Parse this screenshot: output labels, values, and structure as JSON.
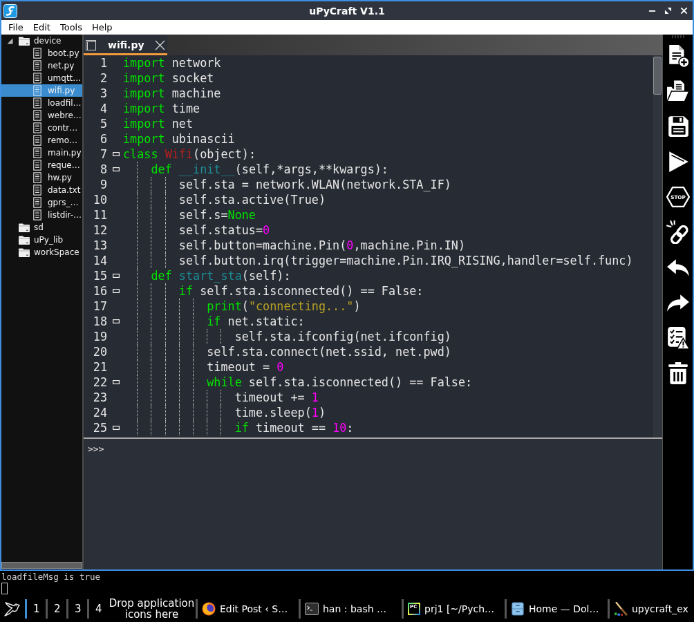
{
  "window": {
    "title": "uPyCraft V1.1"
  },
  "menu": [
    "File",
    "Edit",
    "Tools",
    "Help"
  ],
  "file_tree": [
    {
      "kind": "folder",
      "label": "device",
      "expanded": true,
      "selected": false,
      "children": [
        {
          "kind": "file",
          "label": "boot.py",
          "selected": false
        },
        {
          "kind": "file",
          "label": "net.py",
          "selected": false
        },
        {
          "kind": "file",
          "label": "umqtt…",
          "selected": false
        },
        {
          "kind": "file",
          "label": "wifi.py",
          "selected": true
        },
        {
          "kind": "file",
          "label": "loadfil…",
          "selected": false
        },
        {
          "kind": "file",
          "label": "webre…",
          "selected": false
        },
        {
          "kind": "file",
          "label": "contr…",
          "selected": false
        },
        {
          "kind": "file",
          "label": "remo…",
          "selected": false
        },
        {
          "kind": "file",
          "label": "main.py",
          "selected": false
        },
        {
          "kind": "file",
          "label": "reque…",
          "selected": false
        },
        {
          "kind": "file",
          "label": "hw.py",
          "selected": false
        },
        {
          "kind": "file",
          "label": "data.txt",
          "selected": false
        },
        {
          "kind": "file",
          "label": "gprs_…",
          "selected": false
        },
        {
          "kind": "file",
          "label": "listdir-…",
          "selected": false
        }
      ]
    },
    {
      "kind": "folder",
      "label": "sd",
      "selected": false
    },
    {
      "kind": "folder",
      "label": "uPy_lib",
      "selected": false
    },
    {
      "kind": "folder",
      "label": "workSpace",
      "selected": false
    }
  ],
  "editor": {
    "tabs": [
      {
        "label": "wifi.py",
        "selected": true
      }
    ],
    "lines": [
      {
        "number": "1",
        "collapsible": false,
        "tokens": [
          {
            "kind": "keyword",
            "text": "import"
          },
          {
            "kind": "plain",
            "text": " network"
          }
        ]
      },
      {
        "number": "2",
        "collapsible": false,
        "tokens": [
          {
            "kind": "keyword",
            "text": "import"
          },
          {
            "kind": "plain",
            "text": " socket"
          }
        ]
      },
      {
        "number": "3",
        "collapsible": false,
        "tokens": [
          {
            "kind": "keyword",
            "text": "import"
          },
          {
            "kind": "plain",
            "text": " machine"
          }
        ]
      },
      {
        "number": "4",
        "collapsible": false,
        "tokens": [
          {
            "kind": "keyword",
            "text": "import"
          },
          {
            "kind": "plain",
            "text": " time"
          }
        ]
      },
      {
        "number": "5",
        "collapsible": false,
        "tokens": [
          {
            "kind": "keyword",
            "text": "import"
          },
          {
            "kind": "plain",
            "text": " net"
          }
        ]
      },
      {
        "number": "6",
        "collapsible": false,
        "tokens": [
          {
            "kind": "keyword",
            "text": "import"
          },
          {
            "kind": "plain",
            "text": " ubinascii"
          }
        ]
      },
      {
        "number": "7",
        "collapsible": true,
        "tokens": [
          {
            "kind": "keyword",
            "text": "class"
          },
          {
            "kind": "class",
            "text": " Wifi"
          },
          {
            "kind": "plain",
            "text": "(object):"
          }
        ]
      },
      {
        "number": "8",
        "collapsible": true,
        "tokens": [
          {
            "kind": "keyword",
            "text": "    def"
          },
          {
            "kind": "function",
            "text": " __init__"
          },
          {
            "kind": "plain",
            "text": "(self,*args,**kwargs):"
          }
        ]
      },
      {
        "number": "9",
        "collapsible": false,
        "tokens": [
          {
            "kind": "plain",
            "text": "        self.sta = network.WLAN(network.STA_IF)"
          }
        ]
      },
      {
        "number": "10",
        "collapsible": false,
        "tokens": [
          {
            "kind": "plain",
            "text": "        self.sta.active(True)"
          }
        ]
      },
      {
        "number": "11",
        "collapsible": false,
        "tokens": [
          {
            "kind": "plain",
            "text": "        self.s="
          },
          {
            "kind": "keyword",
            "text": "None"
          }
        ]
      },
      {
        "number": "12",
        "collapsible": false,
        "tokens": [
          {
            "kind": "plain",
            "text": "        self.status="
          },
          {
            "kind": "number",
            "text": "0"
          }
        ]
      },
      {
        "number": "13",
        "collapsible": false,
        "tokens": [
          {
            "kind": "plain",
            "text": "        self.button=machine.Pin("
          },
          {
            "kind": "number",
            "text": "0"
          },
          {
            "kind": "plain",
            "text": ",machine.Pin.IN)"
          }
        ]
      },
      {
        "number": "14",
        "collapsible": false,
        "tokens": [
          {
            "kind": "plain",
            "text": "        self.button.irq(trigger=machine.Pin.IRQ_RISING,handler=self.func)"
          }
        ]
      },
      {
        "number": "15",
        "collapsible": true,
        "tokens": [
          {
            "kind": "keyword",
            "text": "    def"
          },
          {
            "kind": "function",
            "text": " start_sta"
          },
          {
            "kind": "plain",
            "text": "(self):"
          }
        ]
      },
      {
        "number": "16",
        "collapsible": true,
        "tokens": [
          {
            "kind": "keyword",
            "text": "        if"
          },
          {
            "kind": "plain",
            "text": " self.sta.isconnected() == False:"
          }
        ]
      },
      {
        "number": "17",
        "collapsible": false,
        "tokens": [
          {
            "kind": "keyword",
            "text": "            print"
          },
          {
            "kind": "plain",
            "text": "("
          },
          {
            "kind": "string",
            "text": "\"connecting...\""
          },
          {
            "kind": "plain",
            "text": ")"
          }
        ]
      },
      {
        "number": "18",
        "collapsible": true,
        "tokens": [
          {
            "kind": "keyword",
            "text": "            if"
          },
          {
            "kind": "plain",
            "text": " net.static:"
          }
        ]
      },
      {
        "number": "19",
        "collapsible": false,
        "tokens": [
          {
            "kind": "plain",
            "text": "                self.sta.ifconfig(net.ifconfig)"
          }
        ]
      },
      {
        "number": "20",
        "collapsible": false,
        "tokens": [
          {
            "kind": "plain",
            "text": "            self.sta.connect(net.ssid, net.pwd)"
          }
        ]
      },
      {
        "number": "21",
        "collapsible": false,
        "tokens": [
          {
            "kind": "plain",
            "text": "            timeout = "
          },
          {
            "kind": "number",
            "text": "0"
          }
        ]
      },
      {
        "number": "22",
        "collapsible": true,
        "tokens": [
          {
            "kind": "keyword",
            "text": "            while"
          },
          {
            "kind": "plain",
            "text": " self.sta.isconnected() == False:"
          }
        ]
      },
      {
        "number": "23",
        "collapsible": false,
        "tokens": [
          {
            "kind": "plain",
            "text": "                timeout += "
          },
          {
            "kind": "number",
            "text": "1"
          }
        ]
      },
      {
        "number": "24",
        "collapsible": false,
        "tokens": [
          {
            "kind": "plain",
            "text": "                time.sleep("
          },
          {
            "kind": "number",
            "text": "1"
          },
          {
            "kind": "plain",
            "text": ")"
          }
        ]
      },
      {
        "number": "25",
        "collapsible": true,
        "tokens": [
          {
            "kind": "keyword",
            "text": "                if"
          },
          {
            "kind": "plain",
            "text": " timeout == "
          },
          {
            "kind": "number",
            "text": "10"
          },
          {
            "kind": "plain",
            "text": ":"
          }
        ]
      }
    ]
  },
  "console": {
    "prompt": ">>>"
  },
  "toolbar": [
    {
      "kind": "new"
    },
    {
      "kind": "open"
    },
    {
      "kind": "save"
    },
    {
      "kind": "run"
    },
    {
      "kind": "stop",
      "text": "STOP"
    },
    {
      "kind": "connect"
    },
    {
      "kind": "undo"
    },
    {
      "kind": "redo"
    },
    {
      "kind": "check"
    },
    {
      "kind": "clear"
    }
  ],
  "background_terminal": {
    "lines": [
      "loadfileMsg is true"
    ]
  },
  "taskbar": {
    "workspaces": [
      {
        "label": "1",
        "selected": true
      },
      {
        "label": "2",
        "selected": false
      },
      {
        "label": "3",
        "selected": false
      },
      {
        "label": "4",
        "selected": false
      }
    ],
    "drop_hint": "Drop application icons here",
    "tasks": [
      {
        "kind": "browser",
        "title": "Edit Post ‹ S…"
      },
      {
        "kind": "terminal",
        "title": "han : bash …"
      },
      {
        "kind": "ide",
        "icon_text": "PC",
        "title": "prj1 [~/Pych…"
      },
      {
        "kind": "files",
        "title": "Home — Dol…"
      },
      {
        "kind": "paint",
        "title": "upycraft_ex"
      }
    ]
  }
}
